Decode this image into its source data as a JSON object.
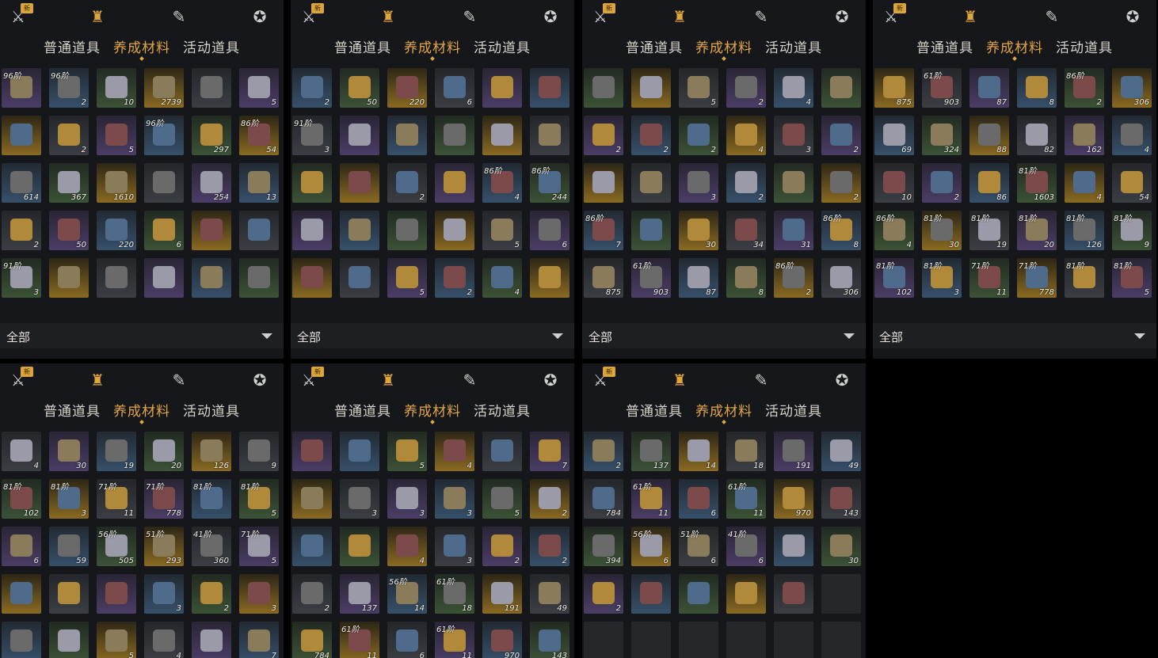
{
  "tabs": {
    "normal": "普通道具",
    "materials": "养成材料",
    "event": "活动道具"
  },
  "new_badge": "新",
  "filter_label": "全部",
  "panels": [
    {
      "id": "p1",
      "rows": [
        [
          [
            "96阶",
            ""
          ],
          [
            "96阶",
            "2"
          ],
          [
            "",
            "10"
          ],
          [
            "",
            "2739"
          ],
          [
            "",
            ""
          ],
          [
            "",
            "5"
          ]
        ],
        [
          [
            "",
            ""
          ],
          [
            "",
            "2"
          ],
          [
            "",
            "5"
          ],
          [
            "96阶",
            ""
          ],
          [
            "",
            "297"
          ],
          [
            "86阶",
            "54"
          ]
        ],
        [
          [
            "",
            "614"
          ],
          [
            "",
            "367"
          ],
          [
            "",
            "1610"
          ],
          [
            "",
            ""
          ],
          [
            "",
            "254"
          ],
          [
            "",
            "13"
          ]
        ],
        [
          [
            "",
            "2"
          ],
          [
            "",
            "50"
          ],
          [
            "",
            "220"
          ],
          [
            "",
            "6"
          ],
          [
            "",
            ""
          ],
          [
            "",
            ""
          ]
        ],
        [
          [
            "91阶",
            "3"
          ],
          [
            "",
            ""
          ],
          [
            "",
            ""
          ],
          [
            "",
            ""
          ],
          [
            "",
            ""
          ],
          [
            "",
            ""
          ]
        ]
      ]
    },
    {
      "id": "p2",
      "rows": [
        [
          [
            "",
            "2"
          ],
          [
            "",
            "50"
          ],
          [
            "",
            "220"
          ],
          [
            "",
            "6"
          ],
          [
            "",
            ""
          ],
          [
            "",
            ""
          ]
        ],
        [
          [
            "91阶",
            "3"
          ],
          [
            "",
            ""
          ],
          [
            "",
            ""
          ],
          [
            "",
            ""
          ],
          [
            "",
            ""
          ],
          [
            "",
            ""
          ]
        ],
        [
          [
            "",
            ""
          ],
          [
            "",
            ""
          ],
          [
            "",
            "2"
          ],
          [
            "",
            ""
          ],
          [
            "86阶",
            "4"
          ],
          [
            "86阶",
            "244"
          ]
        ],
        [
          [
            "",
            ""
          ],
          [
            "",
            ""
          ],
          [
            "",
            ""
          ],
          [
            "",
            ""
          ],
          [
            "",
            "5"
          ],
          [
            "",
            "6"
          ]
        ],
        [
          [
            "",
            ""
          ],
          [
            "",
            ""
          ],
          [
            "",
            "5"
          ],
          [
            "",
            "2"
          ],
          [
            "",
            "4"
          ],
          [
            "",
            ""
          ]
        ]
      ]
    },
    {
      "id": "p3",
      "rows": [
        [
          [
            "",
            ""
          ],
          [
            "",
            ""
          ],
          [
            "",
            "5"
          ],
          [
            "",
            "2"
          ],
          [
            "",
            "4"
          ],
          [
            "",
            ""
          ]
        ],
        [
          [
            "",
            "2"
          ],
          [
            "",
            "2"
          ],
          [
            "",
            "2"
          ],
          [
            "",
            "4"
          ],
          [
            "",
            "3"
          ],
          [
            "",
            "2"
          ]
        ],
        [
          [
            "",
            ""
          ],
          [
            "",
            ""
          ],
          [
            "",
            "3"
          ],
          [
            "",
            "2"
          ],
          [
            "",
            ""
          ],
          [
            "",
            "2"
          ]
        ],
        [
          [
            "86阶",
            "7"
          ],
          [
            "",
            ""
          ],
          [
            "",
            "30"
          ],
          [
            "",
            "34"
          ],
          [
            "",
            "31"
          ],
          [
            "86阶",
            "8"
          ]
        ],
        [
          [
            "",
            "875"
          ],
          [
            "61阶",
            "903"
          ],
          [
            "",
            "87"
          ],
          [
            "",
            "8"
          ],
          [
            "86阶",
            "2"
          ],
          [
            "",
            "306"
          ]
        ]
      ]
    },
    {
      "id": "p4",
      "rows": [
        [
          [
            "",
            "875"
          ],
          [
            "61阶",
            "903"
          ],
          [
            "",
            "87"
          ],
          [
            "",
            "8"
          ],
          [
            "86阶",
            "2"
          ],
          [
            "",
            "306"
          ]
        ],
        [
          [
            "",
            "69"
          ],
          [
            "",
            "324"
          ],
          [
            "",
            "88"
          ],
          [
            "",
            "82"
          ],
          [
            "",
            "162"
          ],
          [
            "",
            "4"
          ]
        ],
        [
          [
            "",
            "10"
          ],
          [
            "",
            "2"
          ],
          [
            "",
            "86"
          ],
          [
            "81阶",
            "1603"
          ],
          [
            "",
            "4"
          ],
          [
            "",
            "54"
          ]
        ],
        [
          [
            "86阶",
            "4"
          ],
          [
            "81阶",
            "30"
          ],
          [
            "81阶",
            "19"
          ],
          [
            "81阶",
            "20"
          ],
          [
            "81阶",
            "126"
          ],
          [
            "81阶",
            "9"
          ]
        ],
        [
          [
            "81阶",
            "102"
          ],
          [
            "81阶",
            "3"
          ],
          [
            "71阶",
            "11"
          ],
          [
            "71阶",
            "778"
          ],
          [
            "81阶",
            ""
          ],
          [
            "81阶",
            "5"
          ]
        ]
      ]
    },
    {
      "id": "p5",
      "rows": [
        [
          [
            "",
            "4"
          ],
          [
            "",
            "30"
          ],
          [
            "",
            "19"
          ],
          [
            "",
            "20"
          ],
          [
            "",
            "126"
          ],
          [
            "",
            "9"
          ]
        ],
        [
          [
            "81阶",
            "102"
          ],
          [
            "81阶",
            "3"
          ],
          [
            "71阶",
            "11"
          ],
          [
            "71阶",
            "778"
          ],
          [
            "81阶",
            ""
          ],
          [
            "81阶",
            "5"
          ]
        ],
        [
          [
            "",
            "6"
          ],
          [
            "",
            "59"
          ],
          [
            "56阶",
            "505"
          ],
          [
            "51阶",
            "293"
          ],
          [
            "41阶",
            "360"
          ],
          [
            "71阶",
            "5"
          ]
        ],
        [
          [
            "",
            ""
          ],
          [
            "",
            ""
          ],
          [
            "",
            ""
          ],
          [
            "",
            "3"
          ],
          [
            "",
            "2"
          ],
          [
            "",
            "3"
          ]
        ],
        [
          [
            "",
            ""
          ],
          [
            "",
            ""
          ],
          [
            "",
            "5"
          ],
          [
            "",
            "4"
          ],
          [
            "",
            ""
          ],
          [
            "",
            "7"
          ]
        ]
      ]
    },
    {
      "id": "p6",
      "rows": [
        [
          [
            "",
            ""
          ],
          [
            "",
            ""
          ],
          [
            "",
            "5"
          ],
          [
            "",
            "4"
          ],
          [
            "",
            ""
          ],
          [
            "",
            "7"
          ]
        ],
        [
          [
            "",
            ""
          ],
          [
            "",
            "3"
          ],
          [
            "",
            "3"
          ],
          [
            "",
            "3"
          ],
          [
            "",
            "5"
          ],
          [
            "",
            "2"
          ]
        ],
        [
          [
            "",
            ""
          ],
          [
            "",
            ""
          ],
          [
            "",
            "4"
          ],
          [
            "",
            "3"
          ],
          [
            "",
            "2"
          ],
          [
            "",
            "2"
          ]
        ],
        [
          [
            "",
            "2"
          ],
          [
            "",
            "137"
          ],
          [
            "56阶",
            "14"
          ],
          [
            "61阶",
            "18"
          ],
          [
            "",
            "191"
          ],
          [
            "",
            "49"
          ]
        ],
        [
          [
            "",
            "784"
          ],
          [
            "61阶",
            "11"
          ],
          [
            "",
            "6"
          ],
          [
            "61阶",
            "11"
          ],
          [
            "",
            "970"
          ],
          [
            "",
            "143"
          ]
        ]
      ]
    },
    {
      "id": "p7",
      "rows": [
        [
          [
            "",
            "2"
          ],
          [
            "",
            "137"
          ],
          [
            "",
            "14"
          ],
          [
            "",
            "18"
          ],
          [
            "",
            "191"
          ],
          [
            "",
            "49"
          ]
        ],
        [
          [
            "",
            "784"
          ],
          [
            "61阶",
            "11"
          ],
          [
            "",
            "6"
          ],
          [
            "61阶",
            "11"
          ],
          [
            "",
            "970"
          ],
          [
            "",
            "143"
          ]
        ],
        [
          [
            "",
            "394"
          ],
          [
            "56阶",
            "6"
          ],
          [
            "51阶",
            "6"
          ],
          [
            "41阶",
            "6"
          ],
          [
            "",
            ""
          ],
          [
            "",
            "30"
          ]
        ],
        [
          [
            "",
            "2"
          ],
          [
            "",
            ""
          ],
          [
            "",
            ""
          ],
          [
            "",
            ""
          ],
          [
            "",
            ""
          ],
          [
            "",
            ""
          ]
        ],
        [
          [
            "",
            ""
          ],
          [
            "",
            ""
          ],
          [
            "",
            ""
          ],
          [
            "",
            ""
          ],
          [
            "",
            ""
          ],
          [
            "",
            ""
          ]
        ]
      ]
    }
  ],
  "colors": {
    "accent": "#e3a646",
    "panel_bg": "#15171a"
  }
}
